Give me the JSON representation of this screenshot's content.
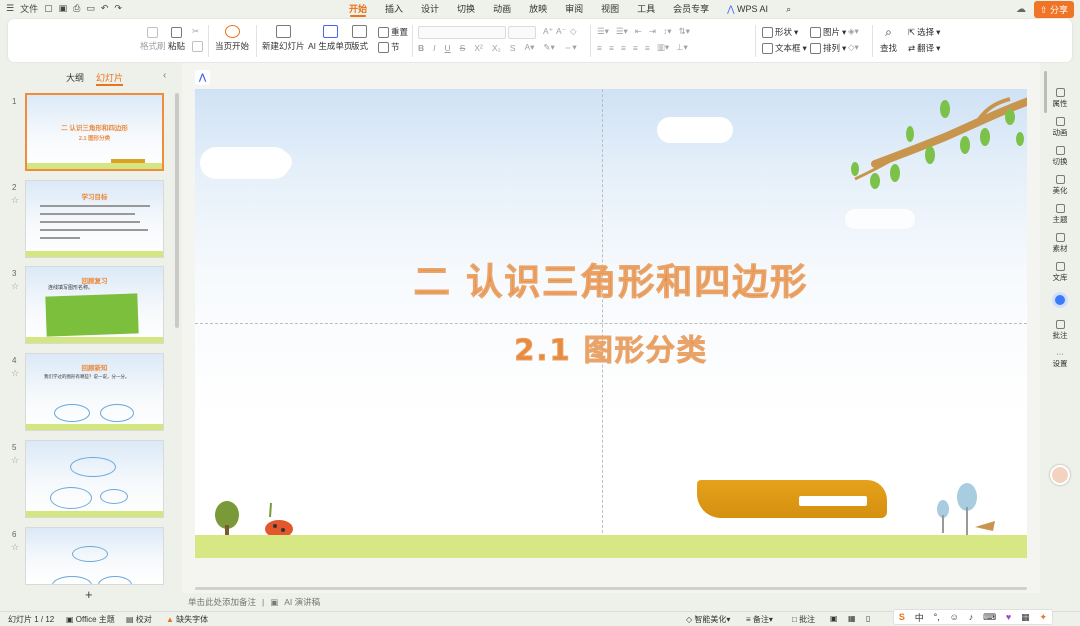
{
  "menubar": {
    "file_label": "文件",
    "tabs": [
      "开始",
      "插入",
      "设计",
      "切换",
      "动画",
      "放映",
      "审阅",
      "视图",
      "工具",
      "会员专享",
      "WPS AI"
    ],
    "active_tab": "开始",
    "share_label": "分享"
  },
  "ribbon": {
    "format_painter": "格式刷",
    "paste": "粘贴",
    "play_current": "当页开始",
    "new_slide": "新建幻灯片",
    "ai_single": "AI 生成单页",
    "layout": "版式",
    "reset": "重置",
    "section": "节",
    "shape": "形状",
    "picture": "图片",
    "textbox": "文本框",
    "arrange": "排列",
    "find": "查找",
    "select": "选择",
    "replace": "翻译"
  },
  "leftpanel": {
    "tab_outline": "大纲",
    "tab_slides": "幻灯片",
    "slides": [
      {
        "num": "1",
        "title": "二   认识三角形和四边形",
        "subtitle": "2.1  图形分类"
      },
      {
        "num": "2",
        "title": "学习目标"
      },
      {
        "num": "3",
        "title": "回顾复习",
        "subtitle": "连线填写图形名称。"
      },
      {
        "num": "4",
        "title": "回顾新知",
        "subtitle": "我们学过的图形有哪些？说一说，分一分。"
      },
      {
        "num": "5"
      },
      {
        "num": "6"
      }
    ],
    "add_slide": "+"
  },
  "slide": {
    "title": "二    认识三角形和四边形",
    "subtitle": "2.1   图形分类"
  },
  "notes": {
    "placeholder": "单击此处添加备注",
    "ai_notes": "AI 演讲稿"
  },
  "rightrail": [
    {
      "label": "属性",
      "icon": "properties-icon"
    },
    {
      "label": "动画",
      "icon": "animation-icon"
    },
    {
      "label": "切换",
      "icon": "transition-icon"
    },
    {
      "label": "美化",
      "icon": "beautify-icon"
    },
    {
      "label": "主题",
      "icon": "theme-icon"
    },
    {
      "label": "素材",
      "icon": "material-icon"
    },
    {
      "label": "文库",
      "icon": "library-icon"
    },
    {
      "label": "批注",
      "icon": "comment-icon"
    },
    {
      "label": "设置",
      "icon": "settings-icon"
    }
  ],
  "status": {
    "slide_counter": "幻灯片 1 / 12",
    "theme": "Office 主题",
    "proofread": "校对",
    "missing_font": "缺失字体",
    "smart_beautify": "智能美化",
    "notes": "备注",
    "comments": "批注"
  },
  "colors": {
    "accent": "#e8741c",
    "slide_title": "#ea8a3c",
    "grass": "#d7e784"
  }
}
